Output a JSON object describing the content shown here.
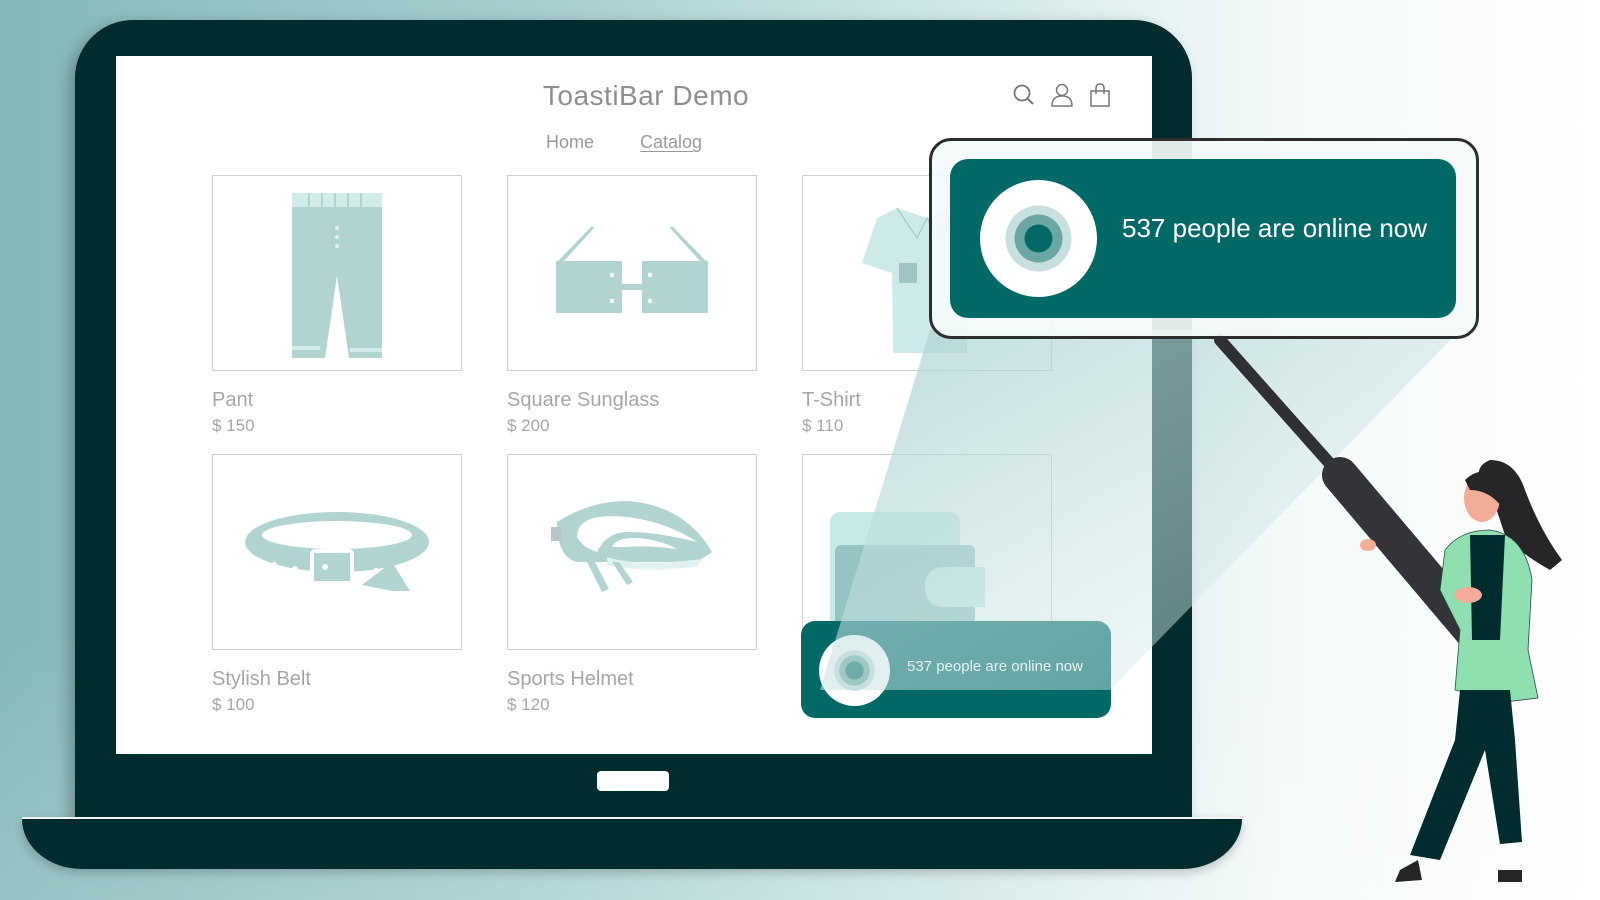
{
  "store": {
    "title": "ToastiBar Demo",
    "nav": [
      {
        "label": "Home",
        "active": false
      },
      {
        "label": "Catalog",
        "active": true
      }
    ],
    "header_icons": [
      "search-icon",
      "user-icon",
      "shopping-bag-icon"
    ]
  },
  "products": [
    {
      "name": "Pant",
      "price": "$ 150",
      "icon": "pant-icon"
    },
    {
      "name": "Square Sunglass",
      "price": "$ 200",
      "icon": "sunglasses-icon"
    },
    {
      "name": "T-Shirt",
      "price": "$ 110",
      "icon": "tshirt-icon"
    },
    {
      "name": "Stylish Belt",
      "price": "$ 100",
      "icon": "belt-icon"
    },
    {
      "name": "Sports Helmet",
      "price": "$ 120",
      "icon": "helmet-icon"
    },
    {
      "name": "",
      "price": "",
      "icon": "wallet-icon"
    }
  ],
  "toast": {
    "message": "537 people are online now",
    "magnified_message": "537 people are online now"
  },
  "colors": {
    "toast_bg": "#006966",
    "laptop": "#002c2e",
    "product_icon": "#b2d4d1",
    "jacket": "#8fe0b0"
  }
}
